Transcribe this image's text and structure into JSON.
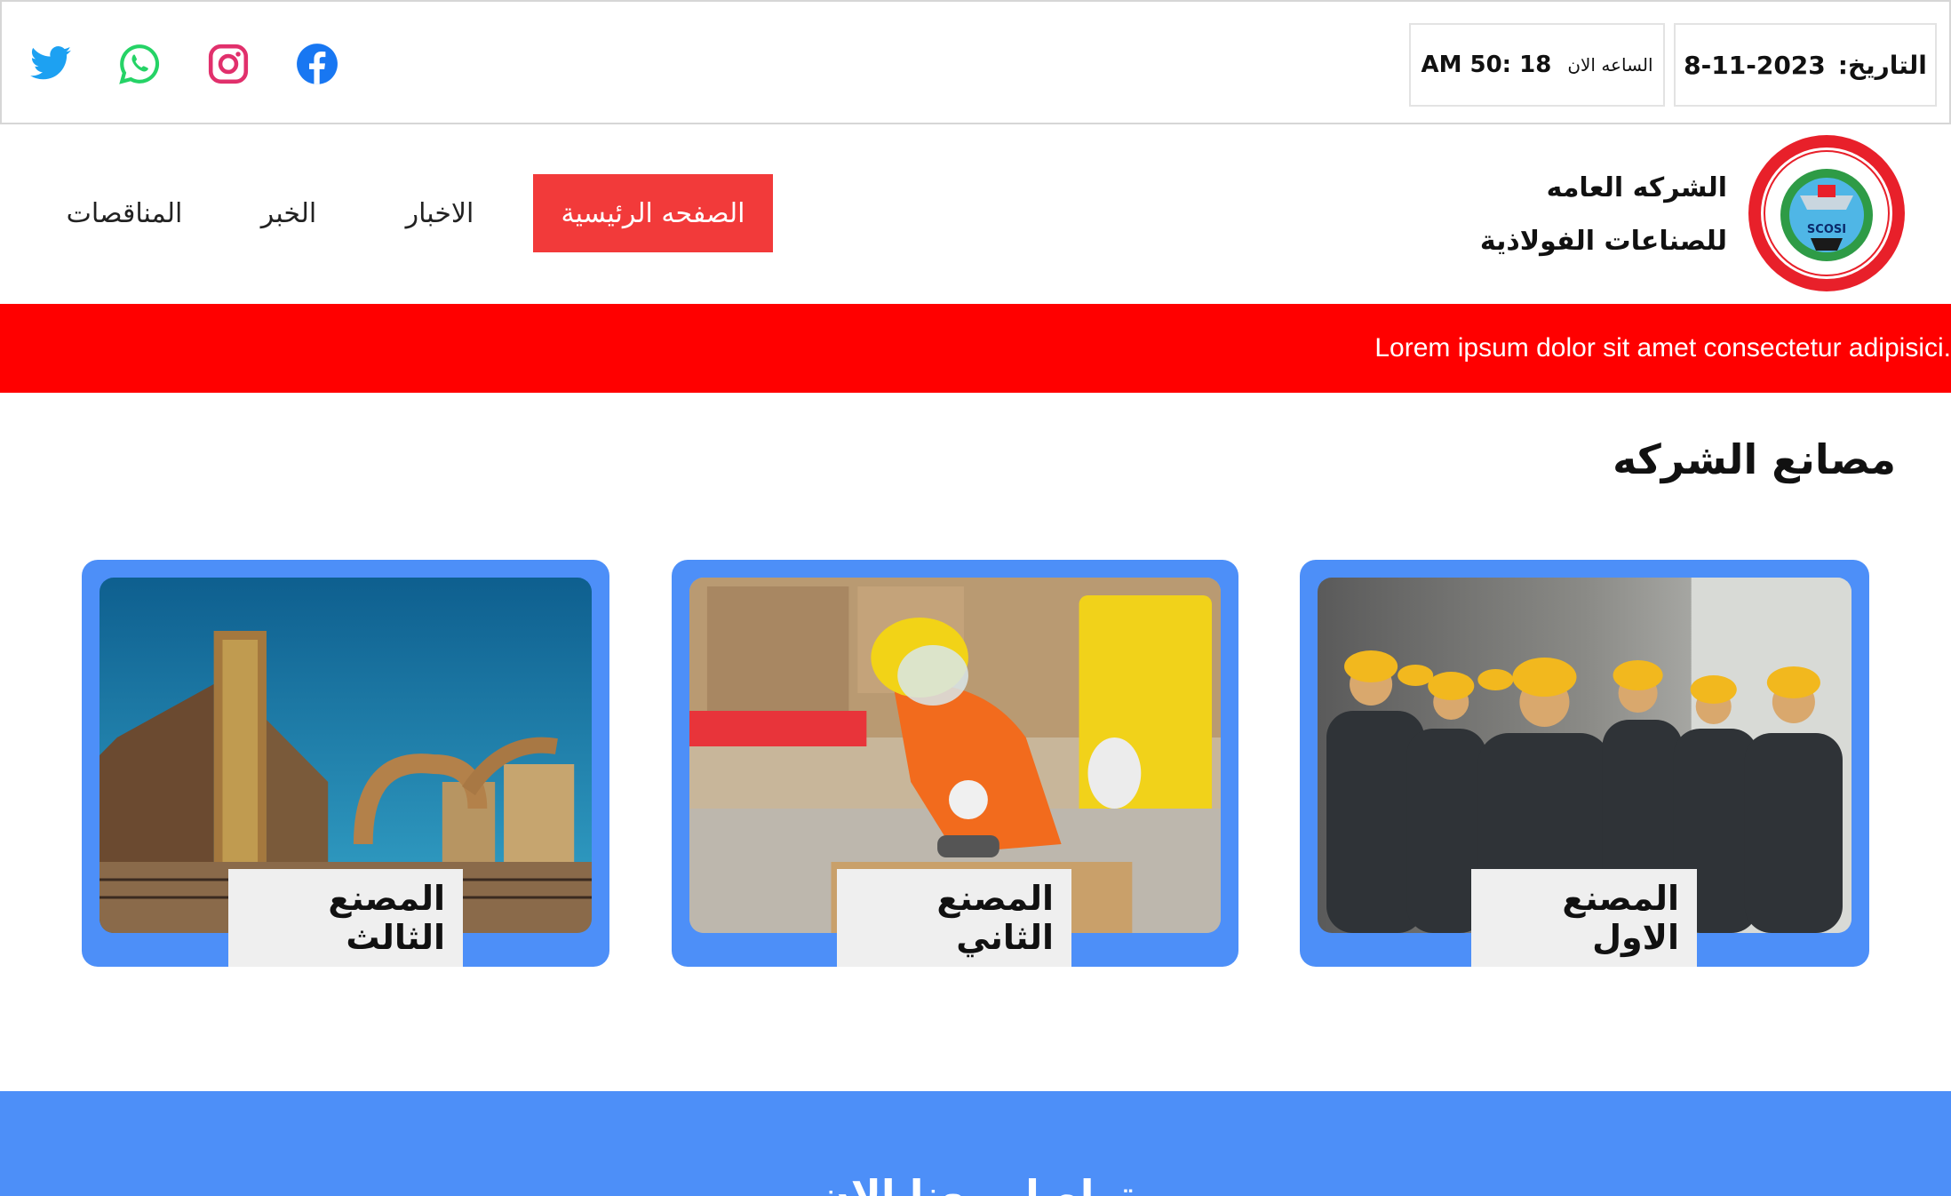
{
  "topbar": {
    "date_label": "التاريخ:",
    "date_value": "8-11-2023",
    "time_label": "الساعه الان",
    "time_value": "AM 50: 18",
    "socials": [
      {
        "icon": "facebook-icon",
        "color": "#1877f2"
      },
      {
        "icon": "instagram-icon",
        "color": "#e1306c"
      },
      {
        "icon": "whatsapp-icon",
        "color": "#25d366"
      },
      {
        "icon": "twitter-icon",
        "color": "#1da1f2"
      }
    ]
  },
  "header": {
    "company_line1": "الشركه العامه",
    "company_line2": "للصناعات الفولاذية",
    "logo_text": "SCOSI",
    "nav": {
      "home": "الصفحه الرئيسية",
      "news": "الاخبار",
      "khabar": "الخبر",
      "tenders": "المناقصات"
    },
    "active_color": "#f23a3a"
  },
  "ticker": {
    "text": ".Lorem ipsum dolor sit amet consectetur adipisici",
    "color": "#ff0000"
  },
  "factories": {
    "title": "مصانع الشركه",
    "cards": [
      {
        "label": "المصنع الاول"
      },
      {
        "label": "المصنع الثاني"
      },
      {
        "label": "المصنع الثالث"
      }
    ],
    "card_color": "#4d8ff8"
  },
  "footer": {
    "title": "تواصل معنا الان"
  }
}
